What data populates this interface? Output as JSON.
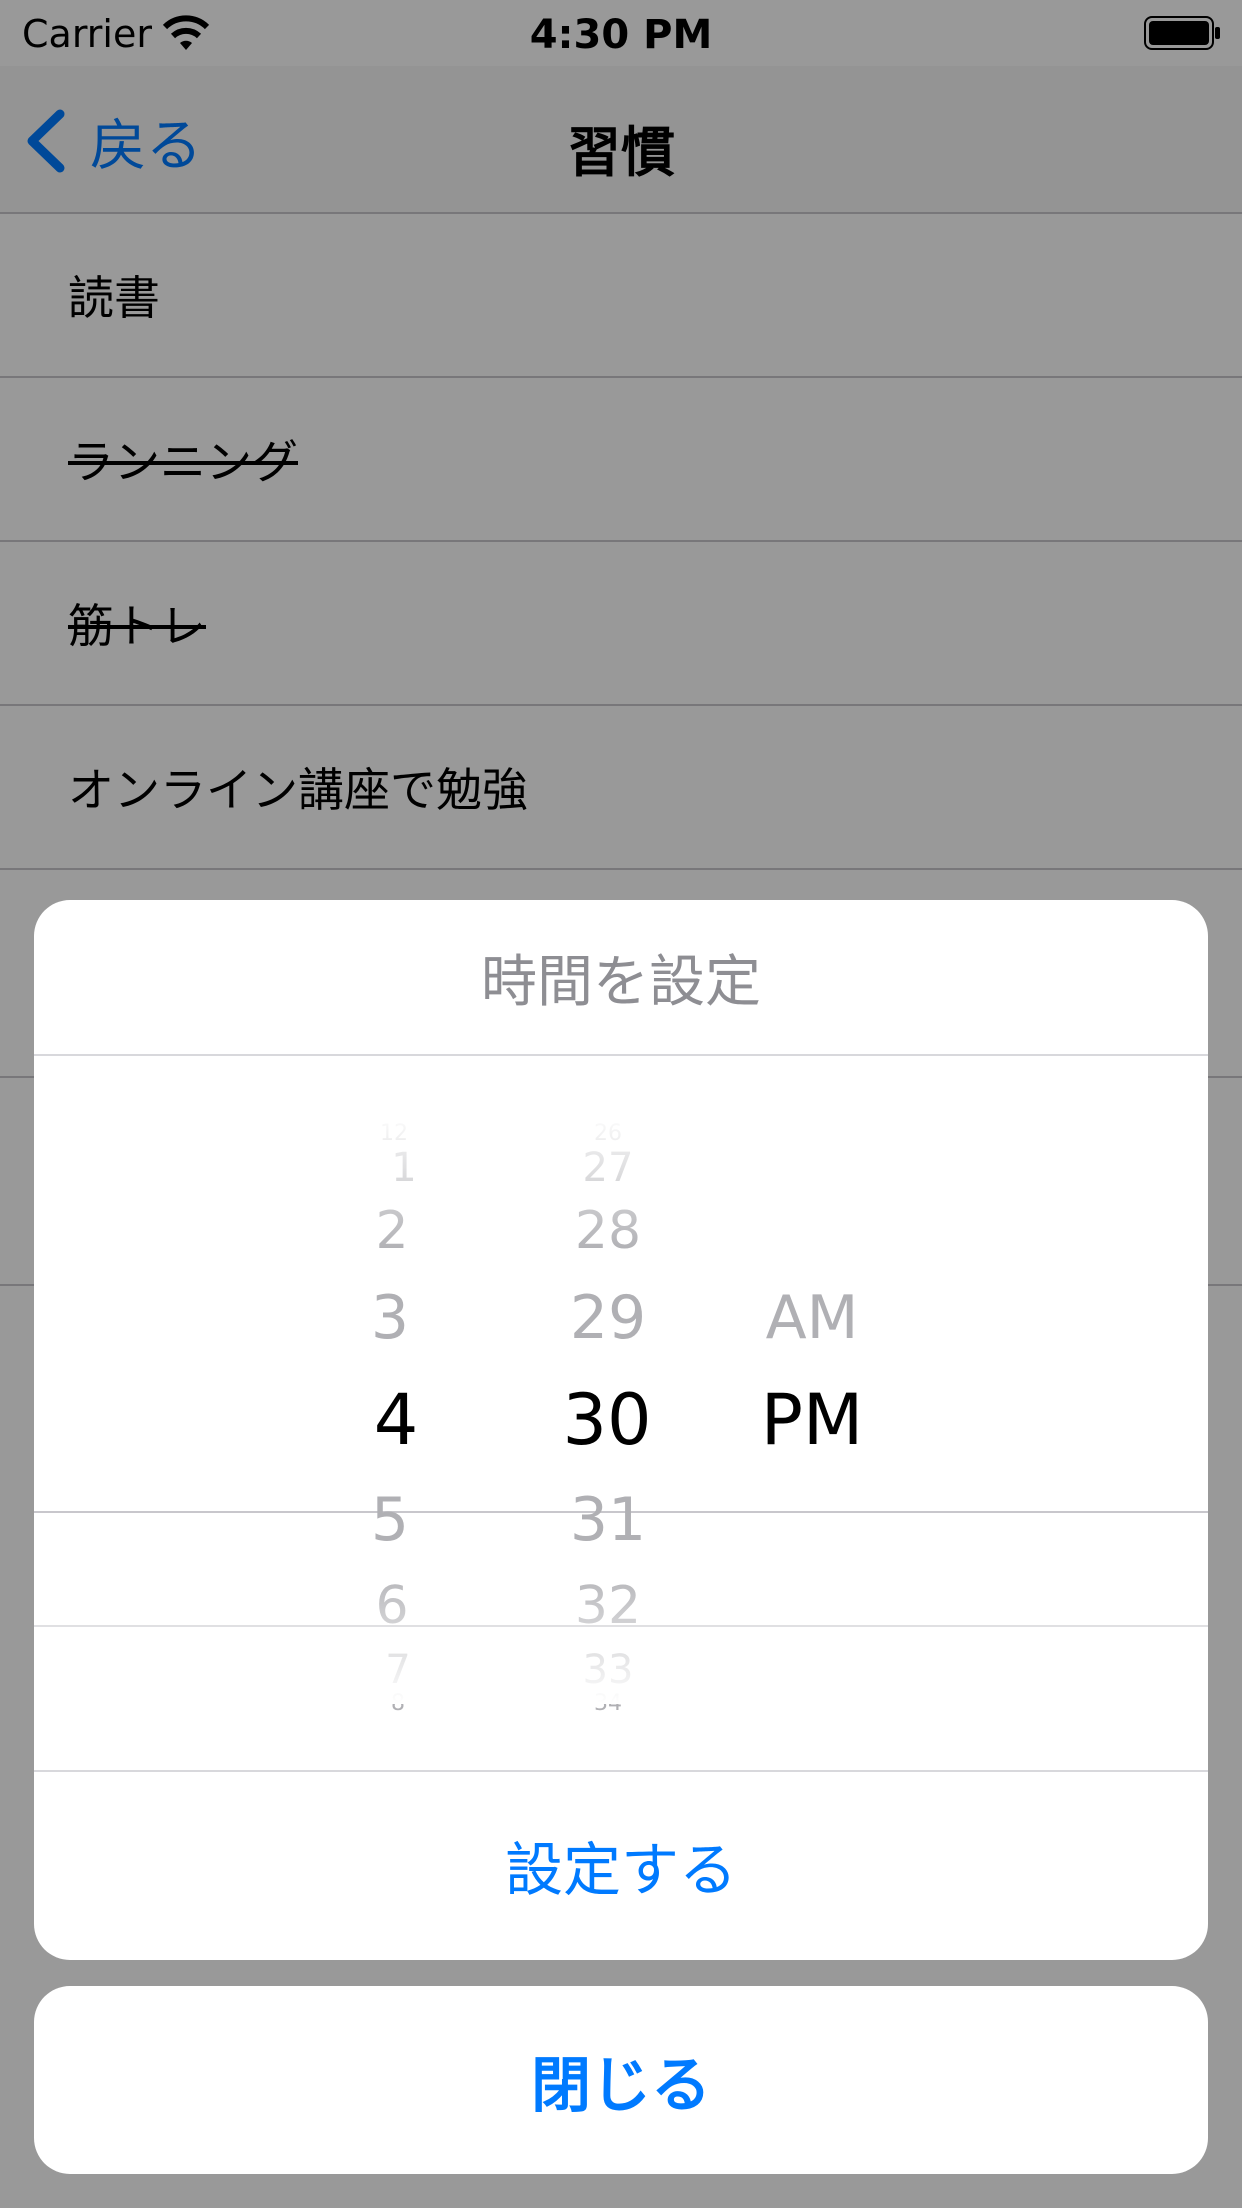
{
  "status_bar": {
    "carrier": "Carrier",
    "time": "4:30 PM"
  },
  "nav": {
    "back_label": "戻る",
    "title": "習慣"
  },
  "habits": [
    {
      "label": "読書",
      "completed": false
    },
    {
      "label": "ランニング",
      "completed": true
    },
    {
      "label": "筋トレ",
      "completed": true
    },
    {
      "label": "オンライン講座で勉強",
      "completed": false
    }
  ],
  "sheet": {
    "title": "時間を設定",
    "hour_column": [
      "12",
      "1",
      "2",
      "3",
      "4",
      "5",
      "6",
      "7",
      "8"
    ],
    "minute_column": [
      "26",
      "27",
      "28",
      "29",
      "30",
      "31",
      "32",
      "33",
      "34"
    ],
    "period_column": [
      "AM",
      "PM"
    ],
    "selected": {
      "hour": "4",
      "minute": "30",
      "period": "PM"
    },
    "set_label": "設定する"
  },
  "cancel_label": "閉じる",
  "colors": {
    "accent": "#007aff",
    "separator": "#c8c7cc",
    "dim_overlay": "rgba(0,0,0,0.4)"
  }
}
